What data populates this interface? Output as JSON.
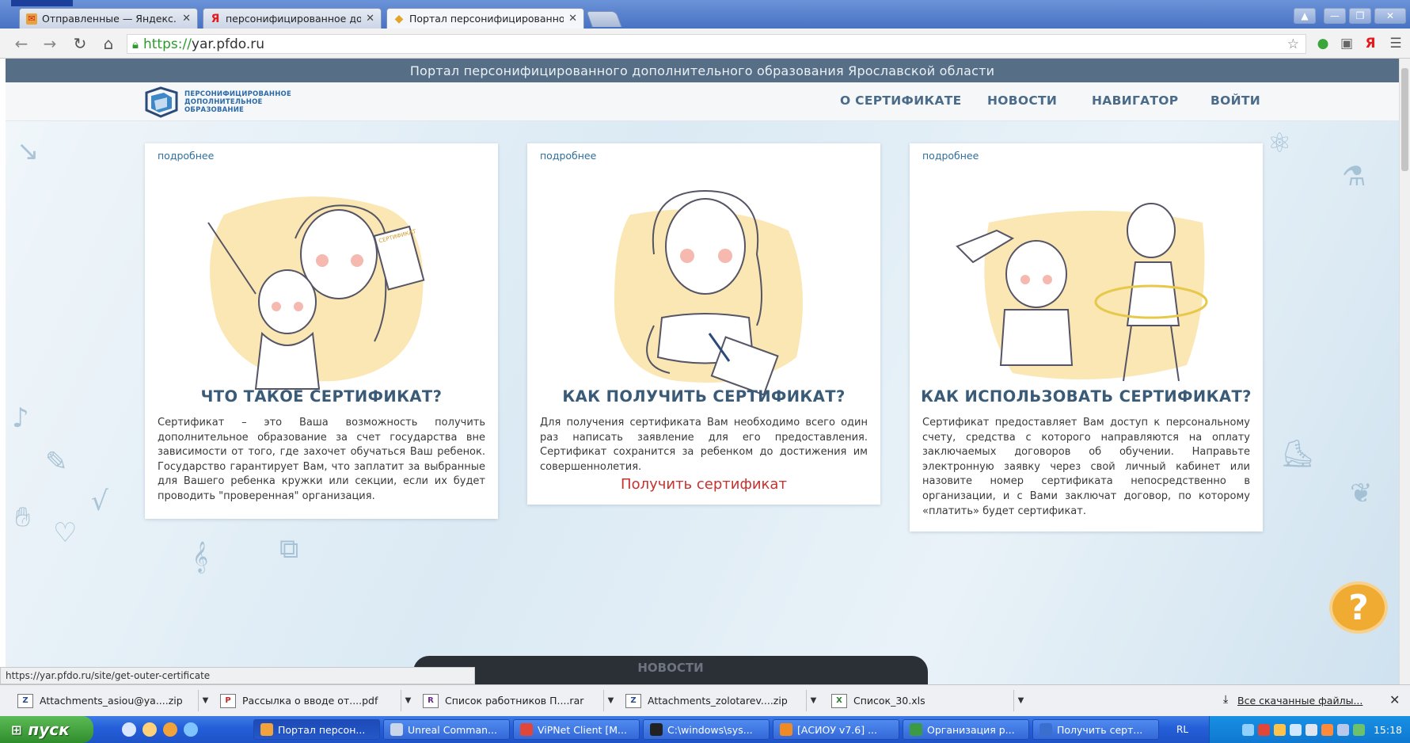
{
  "browser": {
    "tabs": [
      {
        "title": "Отправленные — Яндекс.Почта",
        "icon": "yandex-mail-icon",
        "active": false
      },
      {
        "title": "персонифицированное дополнительное",
        "icon": "yandex-search-icon",
        "active": false
      },
      {
        "title": "Портал персонифицированного",
        "icon": "portal-favicon-icon",
        "active": true
      }
    ],
    "url_scheme": "https://",
    "url_host": "yar.pfdo.ru"
  },
  "portal": {
    "header_title": "Портал персонифицированного дополнительного образования Ярославской области",
    "logo_text": [
      "ПЕРСОНИФИЦИРОВАННОЕ",
      "ДОПОЛНИТЕЛЬНОЕ",
      "ОБРАЗОВАНИЕ"
    ],
    "nav": [
      "О СЕРТИФИКАТЕ",
      "НОВОСТИ",
      "НАВИГАТОР",
      "ВОЙТИ"
    ]
  },
  "cards": [
    {
      "more": "подробнее",
      "title": "ЧТО ТАКОЕ СЕРТИФИКАТ?",
      "text": "Сертификат – это Ваша возможность получить дополнительное образование за счет государства вне зависимости от того, где захочет обучаться Ваш ребенок. Государство гарантирует Вам, что заплатит за выбранные для Вашего ребенка кружки или секции, если их будет проводить \"проверенная\" организация."
    },
    {
      "more": "подробнее",
      "title": "КАК ПОЛУЧИТЬ СЕРТИФИКАТ?",
      "text": "Для получения сертификата Вам необходимо всего один раз написать заявление для его предоставления. Сертификат сохранится за ребенком до достижения им совершеннолетия.",
      "link": "Получить сертификат"
    },
    {
      "more": "подробнее",
      "title": "КАК ИСПОЛЬЗОВАТЬ СЕРТИФИКАТ?",
      "text": "Сертификат предоставляет Вам доступ к персональному счету, средства с которого направляются на оплату заключаемых договоров об обучении. Направьте электронную заявку через свой личный кабинет или назовите номер сертификата непосредственно в организации, и с Вами заключат договор, по которому «платить» будет сертификат."
    }
  ],
  "certificate_label": "СЕРТИФИКАТ",
  "news_peek": "НОВОСТИ",
  "status_url": "https://yar.pfdo.ru/site/get-outer-certificate",
  "downloads": {
    "items": [
      "Attachments_asiou@ya....zip",
      "Рассылка о вводе от....pdf",
      "Список работников П....rar",
      "Attachments_zolotarev....zip",
      "Список_30.xls"
    ],
    "all_label": "Все скачанные файлы..."
  },
  "taskbar": {
    "start": "пуск",
    "windows": [
      "Портал персон...",
      "Unreal Comman...",
      "ViPNet Client [M...",
      "C:\\windows\\sys...",
      "[АСИОУ v7.6] ...",
      "Организация р...",
      "Получить серт..."
    ],
    "lang": "RL",
    "clock": "15:18"
  },
  "colors": {
    "portal_bar": "#566f86",
    "title": "#3a5b78",
    "link_red": "#c7312e",
    "help": "#f0ab32",
    "taskbar": "#245ed8",
    "start": "#3a9a36"
  }
}
